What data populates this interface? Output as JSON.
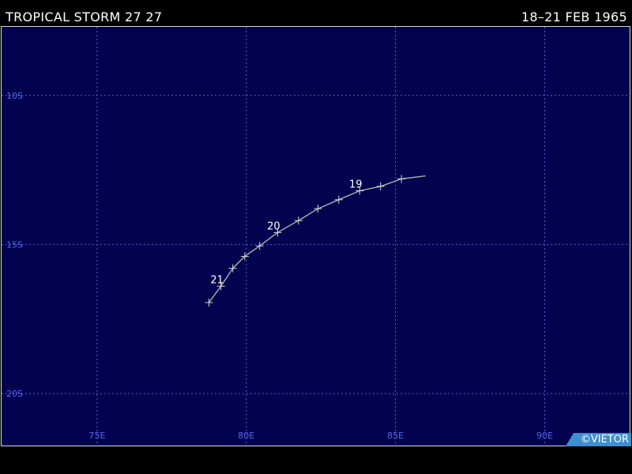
{
  "header": {
    "storm_name": "TROPICAL STORM 27 27",
    "date_range": "18–21 FEB 1965"
  },
  "map": {
    "background_color": "#02024f",
    "grid_color": "#5a5adc",
    "track_color": "#b0b0b0",
    "lon_range": [
      71.8,
      92.9
    ],
    "lat_range_south": [
      7.7,
      21.8
    ],
    "longitude_labels": [
      {
        "lon": 75,
        "text": "75E"
      },
      {
        "lon": 80,
        "text": "80E"
      },
      {
        "lon": 85,
        "text": "85E"
      },
      {
        "lon": 90,
        "text": "90E"
      }
    ],
    "latitude_labels": [
      {
        "lat": 10,
        "text": "10S"
      },
      {
        "lat": 15,
        "text": "15S"
      },
      {
        "lat": 20,
        "text": "20S"
      }
    ]
  },
  "track": {
    "points": [
      {
        "lon": 86.0,
        "lat": 12.7
      },
      {
        "lon": 85.2,
        "lat": 12.8
      },
      {
        "lon": 84.5,
        "lat": 13.05
      },
      {
        "lon": 83.8,
        "lat": 13.2
      },
      {
        "lon": 83.1,
        "lat": 13.5
      },
      {
        "lon": 82.4,
        "lat": 13.8
      },
      {
        "lon": 81.75,
        "lat": 14.2
      },
      {
        "lon": 81.05,
        "lat": 14.6
      },
      {
        "lon": 80.45,
        "lat": 15.05
      },
      {
        "lon": 79.95,
        "lat": 15.4
      },
      {
        "lon": 79.55,
        "lat": 15.8
      },
      {
        "lon": 79.15,
        "lat": 16.4
      },
      {
        "lon": 78.75,
        "lat": 16.95
      }
    ],
    "day_labels": [
      {
        "text": "19",
        "lon": 83.8,
        "lat": 13.2
      },
      {
        "text": "20",
        "lon": 81.05,
        "lat": 14.6
      },
      {
        "text": "21",
        "lon": 79.15,
        "lat": 16.4
      }
    ]
  },
  "credit": {
    "text": "©VIETOR",
    "color": "#3d8fd0"
  }
}
